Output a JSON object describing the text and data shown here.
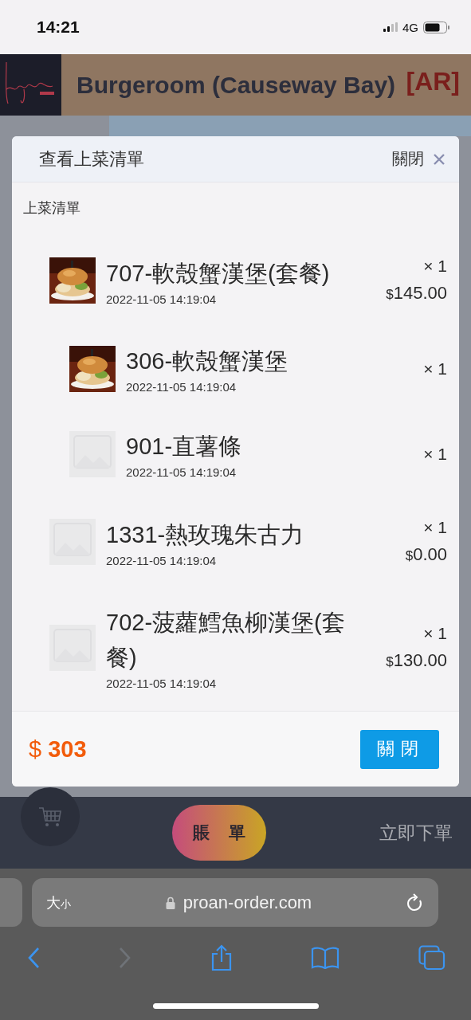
{
  "status_bar": {
    "time": "14:21",
    "network": "4G"
  },
  "header": {
    "title": "Burgeroom (Causeway Bay)",
    "badge": "[AR]"
  },
  "modal": {
    "title": "查看上菜清單",
    "close_label": "關閉",
    "section_label": "上菜清單",
    "items": [
      {
        "name": "707-軟殼蟹漢堡(套餐)",
        "time": "2022-11-05 14:19:04",
        "quantity": "× 1",
        "price": "145.00",
        "currency": "$",
        "children": [
          {
            "name": "306-軟殼蟹漢堡",
            "time": "2022-11-05 14:19:04",
            "quantity": "× 1"
          },
          {
            "name": "901-直薯條",
            "time": "2022-11-05 14:19:04",
            "quantity": "× 1",
            "kind": "placeholder"
          }
        ]
      },
      {
        "name": "1331-熱玫瑰朱古力",
        "time": "2022-11-05 14:19:04",
        "quantity": "× 1",
        "price": "0.00",
        "currency": "$",
        "kind": "placeholder"
      },
      {
        "name": "702-菠蘿鱈魚柳漢堡(套餐)",
        "time": "2022-11-05 14:19:04",
        "quantity": "× 1",
        "price": "130.00",
        "currency": "$",
        "kind": "placeholder"
      }
    ],
    "total_currency": "$",
    "total": "303",
    "close_button": "關閉"
  },
  "order_bar": {
    "bill_button": "賬單",
    "order_button": "立即下單"
  },
  "browser": {
    "text_size_large": "大",
    "text_size_small": "小",
    "url": "proan-order.com",
    "toolbar": [
      {
        "kind": "back",
        "disabled": false
      },
      {
        "kind": "forward",
        "disabled": true
      },
      {
        "kind": "share",
        "disabled": false
      },
      {
        "kind": "bookmarks",
        "disabled": false
      },
      {
        "kind": "tabs",
        "disabled": false
      }
    ]
  }
}
